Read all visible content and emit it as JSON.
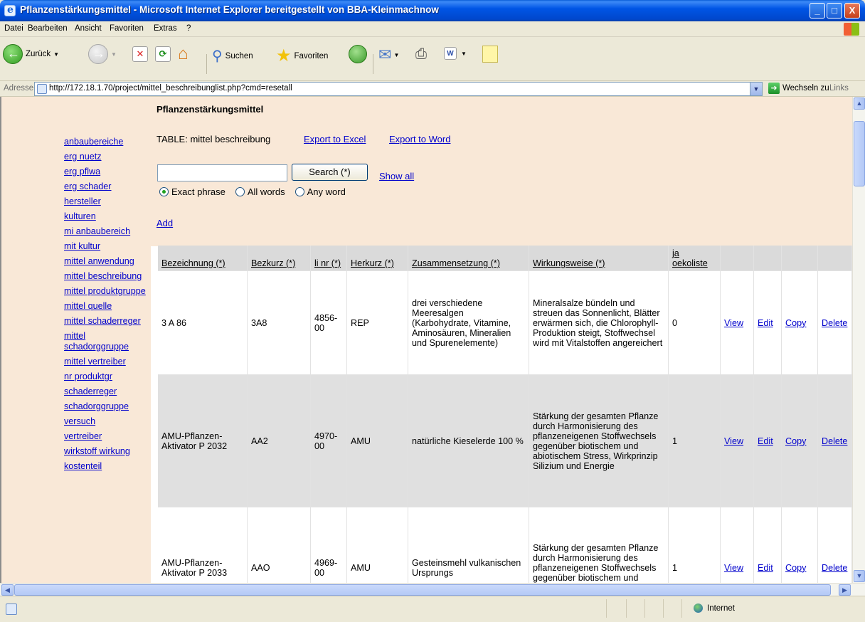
{
  "window": {
    "title": "Pflanzenstärkungsmittel - Microsoft Internet Explorer bereitgestellt von BBA-Kleinmachnow",
    "min_glyph": "_",
    "max_glyph": "□",
    "close_glyph": "X"
  },
  "menu": [
    "Datei",
    "Bearbeiten",
    "Ansicht",
    "Favoriten",
    "Extras",
    "?"
  ],
  "toolbar": {
    "back_label": "Zurück",
    "search_label": "Suchen",
    "favorites_label": "Favoriten"
  },
  "address": {
    "label": "Adresse",
    "url": "http://172.18.1.70/project/mittel_beschreibunglist.php?cmd=resetall",
    "go_label": "Wechseln zu",
    "links_label": "Links"
  },
  "status": {
    "zone": "Internet"
  },
  "page": {
    "title": "Pflanzenstärkungsmittel",
    "table_label": "TABLE: mittel beschreibung",
    "export_excel": "Export to Excel",
    "export_word": "Export to Word",
    "search_value": "",
    "search_button": "Search  (*)",
    "show_all": "Show all",
    "radio_exact": "Exact phrase",
    "radio_all": "All words",
    "radio_any": "Any word",
    "add": "Add"
  },
  "nav": [
    "anbaubereiche",
    "erg nuetz",
    "erg pflwa",
    "erg schader",
    "hersteller",
    "kulturen",
    "mi anbaubereich",
    "mit kultur",
    "mittel anwendung",
    "mittel beschreibung",
    "mittel produktgruppe",
    "mittel quelle",
    "mittel schaderreger",
    "mittel schadorggruppe",
    "mittel vertreiber",
    "nr produktgr",
    "schaderreger",
    "schadorggruppe",
    "versuch",
    "vertreiber",
    "wirkstoff wirkung",
    "kostenteil"
  ],
  "table": {
    "headers": [
      "Bezeichnung (*)",
      "Bezkurz (*)",
      "li nr (*)",
      "Herkurz (*)",
      "Zusammensetzung (*)",
      "Wirkungsweise (*)",
      "ja oekoliste",
      "",
      "",
      "",
      ""
    ],
    "actions": [
      "View",
      "Edit",
      "Copy",
      "Delete"
    ],
    "rows": [
      {
        "bezeichnung": "3 A 86",
        "bezkurz": "3A8",
        "linr": "4856-00",
        "herkurz": "REP",
        "zusammensetzung": "drei verschiedene Meeresalgen (Karbohydrate, Vitamine, Aminosäuren, Mineralien und Spurenelemente)",
        "wirkungsweise": "Mineralsalze bündeln und streuen das Sonnenlicht, Blätter erwärmen sich, die Chlorophyll-Produktion steigt, Stoffwechsel wird mit Vitalstoffen angereichert",
        "oeko": "0"
      },
      {
        "bezeichnung": "AMU-Pflanzen-Aktivator P 2032",
        "bezkurz": "AA2",
        "linr": "4970-00",
        "herkurz": "AMU",
        "zusammensetzung": "natürliche Kieselerde 100 %",
        "wirkungsweise": "Stärkung der gesamten Pflanze durch Harmonisierung des pflanzeneigenen Stoffwechsels gegenüber biotischem und abiotischem Stress, Wirkprinzip Silizium und Energie",
        "oeko": "1"
      },
      {
        "bezeichnung": "AMU-Pflanzen-Aktivator P 2033",
        "bezkurz": "AAO",
        "linr": "4969-00",
        "herkurz": "AMU",
        "zusammensetzung": "Gesteinsmehl vulkanischen Ursprungs",
        "wirkungsweise": "Stärkung der gesamten Pflanze durch Harmonisierung des pflanzeneigenen Stoffwechsels gegenüber biotischem und abiotischem Stress",
        "oeko": "1"
      }
    ]
  }
}
